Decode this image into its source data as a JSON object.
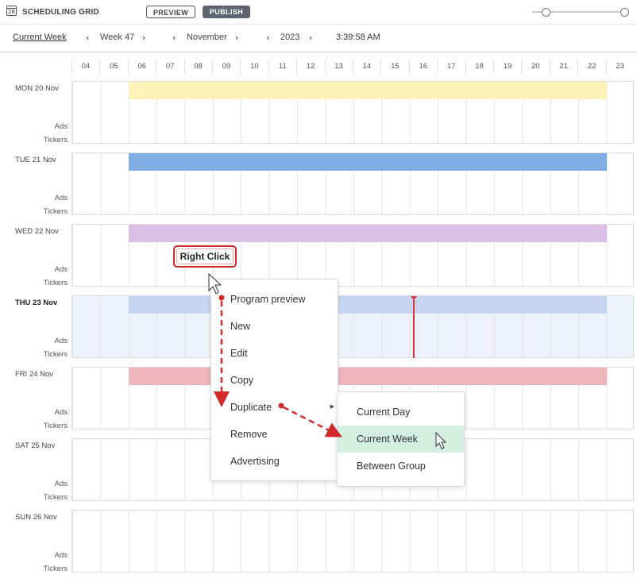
{
  "app": {
    "calendar_icon_text": "28",
    "title": "SCHEDULING GRID",
    "preview_label": "PREVIEW",
    "publish_label": "PUBLISH"
  },
  "nav": {
    "current_week_link": "Current Week",
    "week": "Week 47",
    "month": "November",
    "year": "2023",
    "time": "3:39:58 AM"
  },
  "zoom": {
    "range": [
      0,
      1
    ],
    "value": 0.12
  },
  "hours": [
    "04",
    "05",
    "06",
    "07",
    "08",
    "09",
    "10",
    "11",
    "12",
    "13",
    "14",
    "15",
    "16",
    "17",
    "18",
    "19",
    "20",
    "21",
    "22",
    "23"
  ],
  "days": [
    {
      "label": "MON 20 Nov",
      "color": "#fdf2b8",
      "today": false
    },
    {
      "label": "TUE 21 Nov",
      "color": "#7eaee3",
      "today": false
    },
    {
      "label": "WED 22 Nov",
      "color": "#d9bfe3",
      "today": false
    },
    {
      "label": "THU 23 Nov",
      "color": "#c6d6f2",
      "today": true
    },
    {
      "label": "FRI 24 Nov",
      "color": "#efb5bd",
      "today": false
    },
    {
      "label": "SAT 25 Nov",
      "color": "",
      "today": false
    },
    {
      "label": "SUN 26 Nov",
      "color": "",
      "today": false
    }
  ],
  "row_labels": {
    "ads": "Ads",
    "tickers": "Tickers"
  },
  "context_menu": {
    "items": [
      "Program preview",
      "New",
      "Edit",
      "Copy",
      "Duplicate",
      "Remove",
      "Advertising"
    ]
  },
  "submenu": {
    "items": [
      "Current Day",
      "Current Week",
      "Between Group"
    ],
    "selected": "Current Week"
  },
  "callout": {
    "text": "Right Click"
  },
  "colors": {
    "accent_red": "#d12a2a",
    "highlight_green": "#d2efdf",
    "now_line": "#d9363e"
  }
}
